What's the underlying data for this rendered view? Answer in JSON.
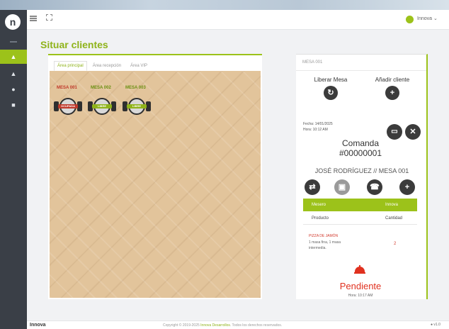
{
  "header": {
    "user_name": "Innova ⌄"
  },
  "page": {
    "title": "Situar clientes"
  },
  "tabs": [
    {
      "label": "Área principal"
    },
    {
      "label": "Área recepción"
    },
    {
      "label": "Área VIP"
    }
  ],
  "tables": [
    {
      "label": "MESA 001",
      "label_color": "#c0392b",
      "badge": "OCUPADA",
      "badge_color": "#c0392b"
    },
    {
      "label": "MESA 002",
      "label_color": "#6a8f12",
      "badge": "LIBRE",
      "badge_color": "#8fb31a"
    },
    {
      "label": "MESA 003",
      "label_color": "#6a8f12",
      "badge": "LIBRE",
      "badge_color": "#8fb31a"
    }
  ],
  "detail": {
    "header": "MESA 001",
    "liberar_label": "Liberar Mesa",
    "anadir_label": "Añadir cliente",
    "fecha_label": "Fecha:",
    "fecha_value": "14/01/2025",
    "hora_label": "Hora:",
    "hora_value": "10:12 AM",
    "comanda_title": "Comanda",
    "comanda_number": "#00000001",
    "client_line": "JOSÉ RODRÍGUEZ // MESA 001",
    "grid_col_left": "Mesero",
    "grid_col_right": "Innova",
    "col_producto": "Producto",
    "col_cantidad": "Cantidad",
    "product_name": "PIZZA DE JAMÓN",
    "product_desc": "1 masa fina, 1 masa intermedia.",
    "product_qty": "2",
    "status": "Pendiente",
    "status_time": "Hora: 10:17 AM"
  },
  "footer": {
    "brand": "Innova",
    "copyright_prefix": "Copyright © 2019-2025",
    "copyright_link": "Innova Desarrollos",
    "copyright_suffix": ". Todos los derechos reservados.",
    "right": "● v1.0"
  },
  "colors": {
    "accent": "#9cc21a",
    "sidebar": "#3a3f47",
    "danger": "#e0311f"
  }
}
